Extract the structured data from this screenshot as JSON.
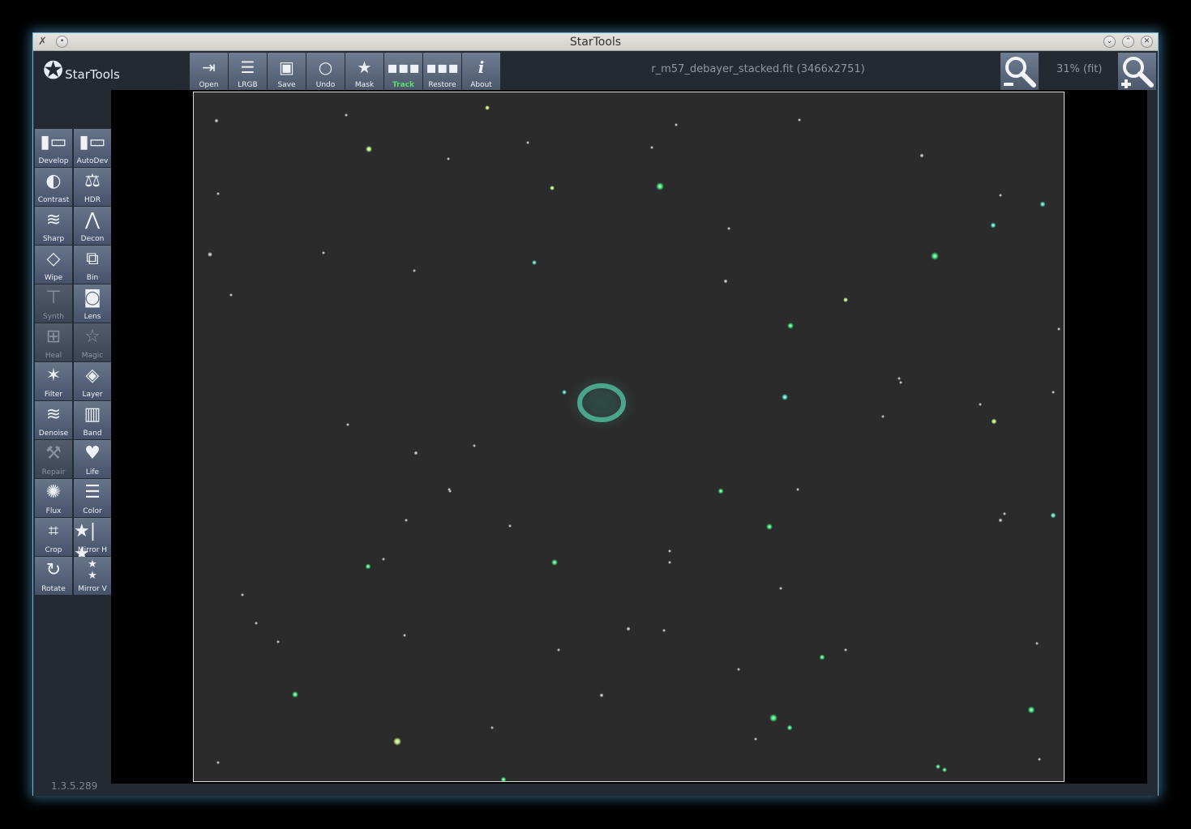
{
  "window": {
    "title": "StarTools"
  },
  "logo": {
    "text": "StarTools"
  },
  "toolbar": {
    "buttons": [
      {
        "label": "Open",
        "icon": "open-icon"
      },
      {
        "label": "LRGB",
        "icon": "lrgb-icon"
      },
      {
        "label": "Save",
        "icon": "save-icon"
      },
      {
        "label": "Undo",
        "icon": "undo-icon"
      },
      {
        "label": "Mask",
        "icon": "mask-icon"
      },
      {
        "label": "Track",
        "icon": "track-icon"
      },
      {
        "label": "Restore",
        "icon": "restore-icon"
      },
      {
        "label": "About",
        "icon": "about-icon"
      }
    ]
  },
  "file": {
    "name": "r_m57_debayer_stacked.fit (3466x2751)"
  },
  "zoom": {
    "level": "31% (fit)"
  },
  "tools": [
    {
      "label": "Develop",
      "enabled": true
    },
    {
      "label": "AutoDev",
      "enabled": true
    },
    {
      "label": "Contrast",
      "enabled": true
    },
    {
      "label": "HDR",
      "enabled": true
    },
    {
      "label": "Sharp",
      "enabled": true
    },
    {
      "label": "Decon",
      "enabled": true
    },
    {
      "label": "Wipe",
      "enabled": true
    },
    {
      "label": "Bin",
      "enabled": true
    },
    {
      "label": "Synth",
      "enabled": false
    },
    {
      "label": "Lens",
      "enabled": true
    },
    {
      "label": "Heal",
      "enabled": false
    },
    {
      "label": "Magic",
      "enabled": false
    },
    {
      "label": "Filter",
      "enabled": true
    },
    {
      "label": "Layer",
      "enabled": true
    },
    {
      "label": "Denoise",
      "enabled": true
    },
    {
      "label": "Band",
      "enabled": true
    },
    {
      "label": "Repair",
      "enabled": false
    },
    {
      "label": "Life",
      "enabled": true
    },
    {
      "label": "Flux",
      "enabled": true
    },
    {
      "label": "Color",
      "enabled": true
    },
    {
      "label": "Crop",
      "enabled": true
    },
    {
      "label": "Mirror H",
      "enabled": true
    },
    {
      "label": "Rotate",
      "enabled": true
    },
    {
      "label": "Mirror V",
      "enabled": true
    }
  ],
  "version": "1.3.5.289",
  "colors": {
    "button_top": "#6f7d93",
    "button_bottom": "#4c586b",
    "track_label": "#57e06a",
    "star_green": "#3ee07a",
    "nebula_ring": "#4fb89a"
  }
}
